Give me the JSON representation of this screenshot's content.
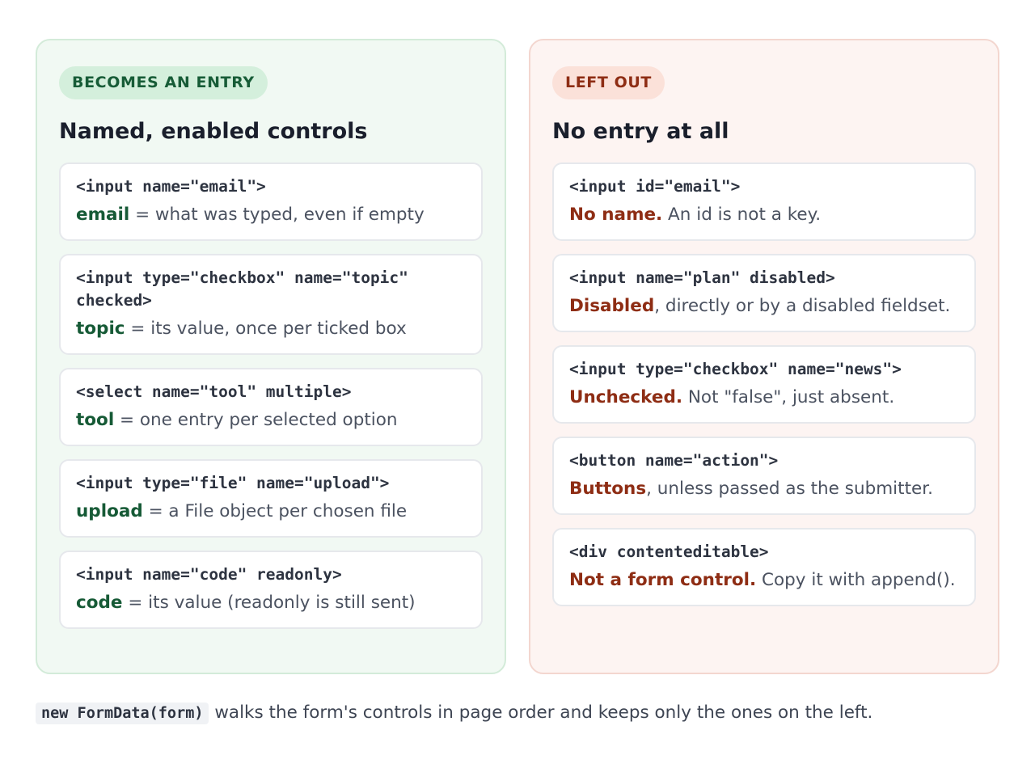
{
  "left": {
    "badge": "BECOMES AN ENTRY",
    "heading": "Named, enabled controls",
    "cards": [
      {
        "code": "<input name=\"email\">",
        "key": "email",
        "rest": " = what was typed, even if empty"
      },
      {
        "code": "<input type=\"checkbox\" name=\"topic\"\nchecked>",
        "key": "topic",
        "rest": " = its value, once per ticked box"
      },
      {
        "code": "<select name=\"tool\" multiple>",
        "key": "tool",
        "rest": " = one entry per selected option"
      },
      {
        "code": "<input type=\"file\" name=\"upload\">",
        "key": "upload",
        "rest": " = a File object per chosen file"
      },
      {
        "code": "<input name=\"code\" readonly>",
        "key": "code",
        "rest": " = its value (readonly is still sent)"
      }
    ]
  },
  "right": {
    "badge": "LEFT OUT",
    "heading": "No entry at all",
    "cards": [
      {
        "code": "<input id=\"email\">",
        "key": "No name.",
        "rest": " An id is not a key."
      },
      {
        "code": "<input name=\"plan\" disabled>",
        "key": "Disabled",
        "rest": ", directly or by a disabled fieldset."
      },
      {
        "code": "<input type=\"checkbox\" name=\"news\">",
        "key": "Unchecked.",
        "rest": " Not \"false\", just absent."
      },
      {
        "code": "<button name=\"action\">",
        "key": "Buttons",
        "rest": ", unless passed as the submitter."
      },
      {
        "code": "<div contenteditable>",
        "key": "Not a form control.",
        "rest": " Copy it with append()."
      }
    ]
  },
  "footer": {
    "code": "new FormData(form)",
    "text": " walks the form's controls in page order and keeps only the ones on the left."
  },
  "colors": {
    "green_accent": "#165a36",
    "red_accent": "#8e2d14",
    "green_panel": "#f1f9f3",
    "red_panel": "#fdf4f2"
  }
}
